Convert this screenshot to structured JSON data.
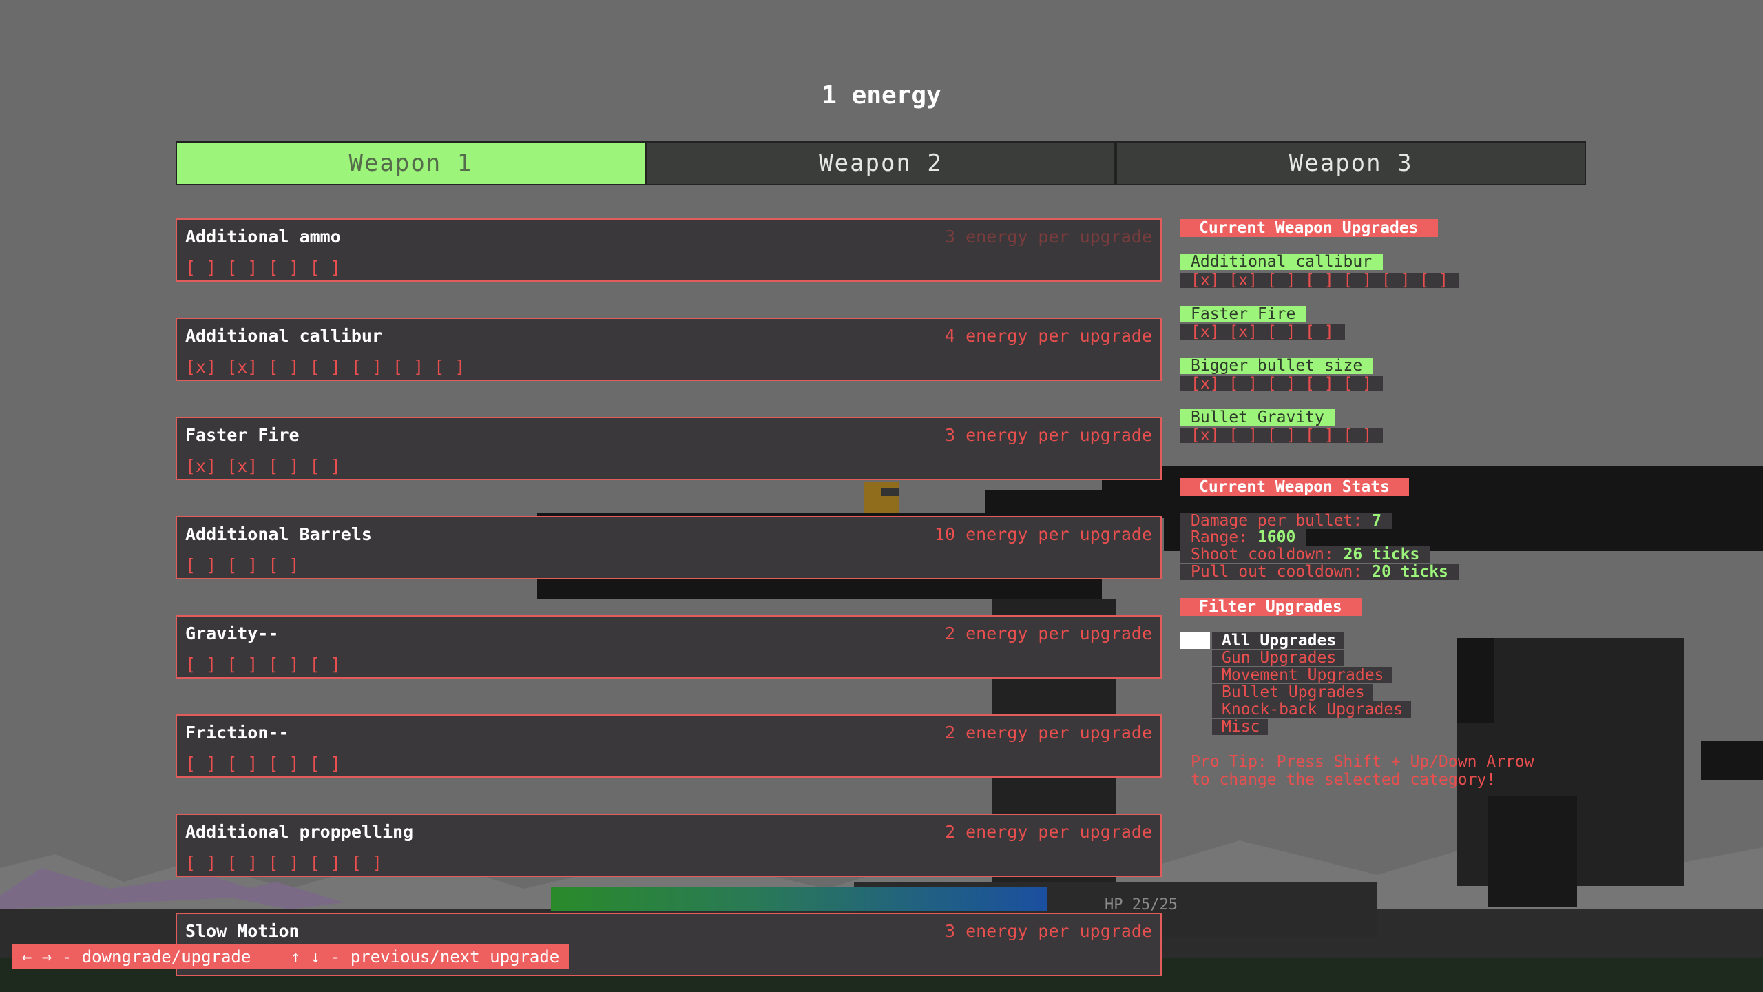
{
  "energy_label": "1 energy",
  "tabs": [
    "Weapon 1",
    "Weapon 2",
    "Weapon 3"
  ],
  "upgrades": [
    {
      "name": "Additional ammo",
      "cost": "3 energy per upgrade",
      "boxes": "[ ] [ ] [ ] [ ]"
    },
    {
      "name": "Additional callibur",
      "cost": "4 energy per upgrade",
      "boxes": "[x] [x] [ ] [ ] [ ] [ ] [ ]"
    },
    {
      "name": "Faster Fire",
      "cost": "3 energy per upgrade",
      "boxes": "[x] [x] [ ] [ ]"
    },
    {
      "name": "Additional Barrels",
      "cost": "10 energy per upgrade",
      "boxes": "[ ] [ ] [ ]"
    },
    {
      "name": "Gravity--",
      "cost": "2 energy per upgrade",
      "boxes": "[ ] [ ] [ ] [ ]"
    },
    {
      "name": "Friction--",
      "cost": "2 energy per upgrade",
      "boxes": "[ ] [ ] [ ] [ ]"
    },
    {
      "name": "Additional proppelling",
      "cost": "2 energy per upgrade",
      "boxes": "[ ] [ ] [ ] [ ] [ ]"
    },
    {
      "name": "Slow Motion",
      "cost": "3 energy per upgrade",
      "boxes": ""
    }
  ],
  "current_upgrades": {
    "header": "Current Weapon Upgrades",
    "items": [
      {
        "name": "Additional callibur",
        "boxes": "[x] [x] [ ] [ ] [ ] [ ] [ ]"
      },
      {
        "name": "Faster Fire",
        "boxes": "[x] [x] [ ] [ ]"
      },
      {
        "name": "Bigger bullet size",
        "boxes": "[x] [ ] [ ] [ ] [ ]"
      },
      {
        "name": "Bullet Gravity",
        "boxes": "[x] [ ] [ ] [ ] [ ]"
      }
    ]
  },
  "stats": {
    "header": "Current Weapon Stats",
    "damage_label": "Damage per bullet: ",
    "damage_value": "7",
    "range_label": "Range: ",
    "range_value": "1600",
    "shoot_label": "Shoot cooldown: ",
    "shoot_value": "26 ticks",
    "pull_label": "Pull out cooldown: ",
    "pull_value": "20 ticks"
  },
  "filters": {
    "header": "Filter Upgrades",
    "options": [
      "All Upgrades",
      "Gun Upgrades",
      "Movement Upgrades",
      "Bullet Upgrades",
      "Knock-back Upgrades",
      "Misc"
    ],
    "selected": "All Upgrades"
  },
  "tip_line1": "Pro Tip: Press Shift + Up/Down Arrow",
  "tip_line2": "to change the selected category!",
  "controls": "← → - downgrade/upgrade    ↑ ↓ - previous/next upgrade",
  "hp_label": "HP 25/25",
  "colors": {
    "accent": "#ee5f5f",
    "active_tab": "#9cf57a",
    "panel": "#3a383b"
  }
}
